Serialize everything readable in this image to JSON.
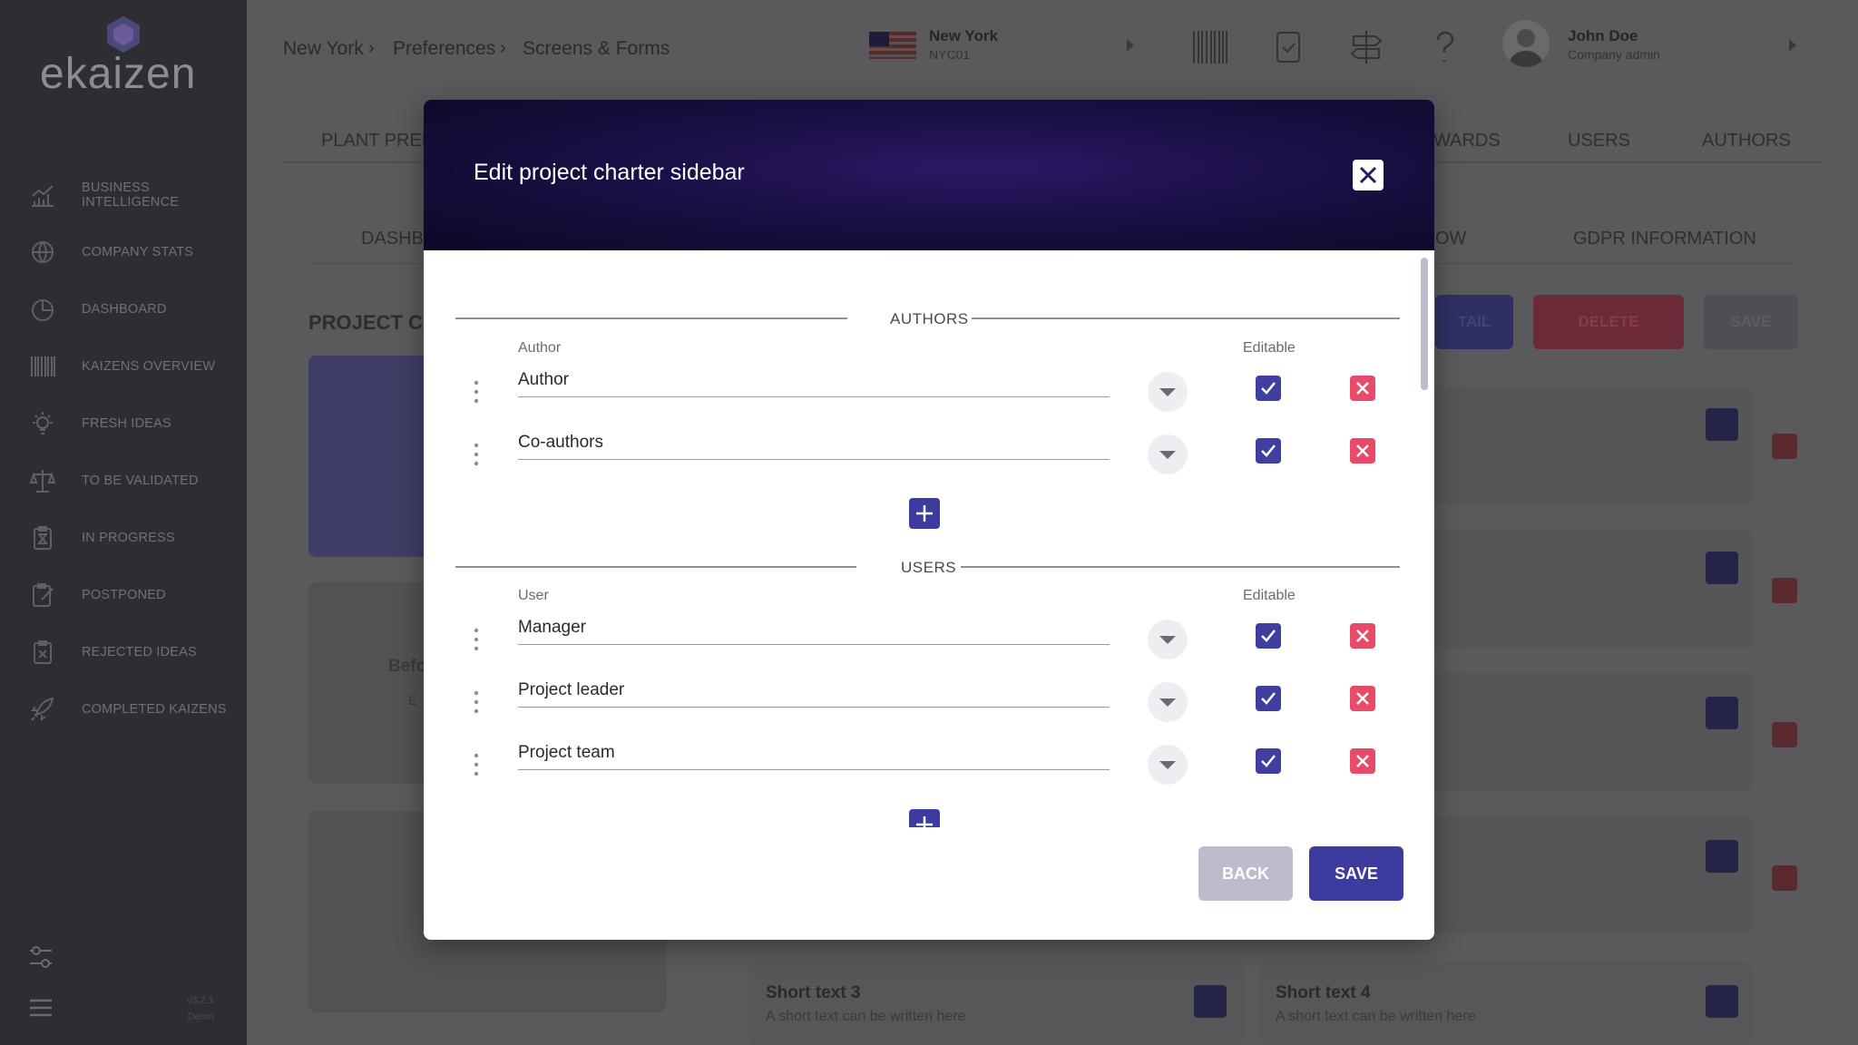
{
  "app": {
    "logo_text": "ekaizen",
    "version": "v3.2.1",
    "environment": "Demo"
  },
  "sidebar": {
    "items": [
      {
        "label": "BUSINESS INTELLIGENCE",
        "icon": "chart-icon"
      },
      {
        "label": "COMPANY STATS",
        "icon": "globe-icon"
      },
      {
        "label": "DASHBOARD",
        "icon": "pie-chart-icon"
      },
      {
        "label": "KAIZENS OVERVIEW",
        "icon": "barcode-icon"
      },
      {
        "label": "FRESH IDEAS",
        "icon": "lightbulb-icon"
      },
      {
        "label": "TO BE VALIDATED",
        "icon": "scale-icon"
      },
      {
        "label": "IN PROGRESS",
        "icon": "hourglass-clipboard-icon"
      },
      {
        "label": "POSTPONED",
        "icon": "clipboard-edit-icon"
      },
      {
        "label": "REJECTED IDEAS",
        "icon": "clipboard-x-icon"
      },
      {
        "label": "COMPLETED KAIZENS",
        "icon": "rocket-icon"
      }
    ]
  },
  "header": {
    "breadcrumb": [
      "New York",
      "Preferences",
      "Screens & Forms"
    ],
    "location": {
      "name": "New York",
      "code": "NYC01"
    },
    "user": {
      "name": "John Doe",
      "role": "Company admin"
    }
  },
  "background": {
    "tabs": [
      "PLANT PREF",
      "WARDS",
      "USERS",
      "AUTHORS"
    ],
    "subtabs": [
      "DASHB",
      "OW",
      "GDPR INFORMATION"
    ],
    "section_title": "PROJECT CH",
    "buttons": {
      "detail": "TAIL",
      "delete": "DELETE",
      "save": "SAVE"
    },
    "card_text": [
      "Befo",
      "E"
    ],
    "short_texts": [
      {
        "title": "Short text 3",
        "subtitle": "A short text can be written here"
      },
      {
        "title": "Short text 4",
        "subtitle": "A short text can be written here"
      }
    ]
  },
  "modal": {
    "title": "Edit project charter sidebar",
    "sections": [
      {
        "title": "AUTHORS",
        "field_label": "Author",
        "editable_label": "Editable",
        "rows": [
          {
            "value": "Author",
            "editable": true
          },
          {
            "value": "Co-authors",
            "editable": true
          }
        ]
      },
      {
        "title": "USERS",
        "field_label": "User",
        "editable_label": "Editable",
        "rows": [
          {
            "value": "Manager",
            "editable": true
          },
          {
            "value": "Project leader",
            "editable": true
          },
          {
            "value": "Project team",
            "editable": true
          }
        ]
      }
    ],
    "buttons": {
      "back": "BACK",
      "save": "SAVE"
    }
  },
  "colors": {
    "accent": "#3c3c9e",
    "danger": "#e84a6a",
    "header_bg": "#1a0f45",
    "sidebar_bg": "#2e2d31",
    "back_button": "#bcbccc"
  }
}
